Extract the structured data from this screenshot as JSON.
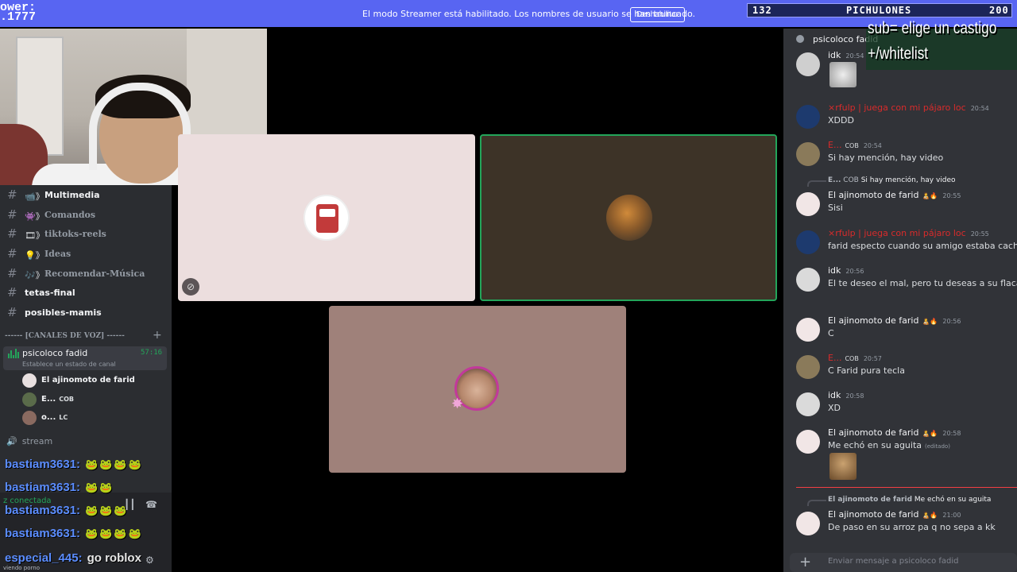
{
  "stream_overlay": {
    "top_left_text": [
      "ower:",
      ".1777"
    ],
    "counter": {
      "current": "132",
      "label": "PICHULONES",
      "goal": "200"
    },
    "sub_lines": [
      "sub= elige un castigo",
      "+/whitelist"
    ]
  },
  "banner": {
    "text": "El modo Streamer está habilitado. Los nombres de usuario se han truncado.",
    "button": "Deshabilitar"
  },
  "sidebar": {
    "channels": [
      {
        "emoji": "📹》",
        "name": "Multimedia",
        "unread": true
      },
      {
        "emoji": "👾》",
        "name": "Comandos",
        "unread": false
      },
      {
        "emoji": "🎞》",
        "name": "tiktoks-reels",
        "unread": false
      },
      {
        "emoji": "💡》",
        "name": "Ideas",
        "unread": false
      },
      {
        "emoji": "🎶》",
        "name": "Recomendar-Música",
        "unread": false
      },
      {
        "emoji": "",
        "name": "tetas-final",
        "unread": true
      },
      {
        "emoji": "",
        "name": "posibles-mamis",
        "unread": true
      }
    ],
    "voice_header": "------ [CANALES DE VOZ] ------",
    "active_voice": {
      "name": "psicoloco fadid",
      "time": "57:16",
      "status": "Establece un estado de canal"
    },
    "voice_users": [
      {
        "name": "El ajinomoto de farid",
        "tag": "",
        "color": "#e8e0e0"
      },
      {
        "name": "E...",
        "tag": "COB",
        "color": "#5a6b4a"
      },
      {
        "name": "o...",
        "tag": "LC",
        "color": "#8a6a60"
      }
    ],
    "stream_channel": "stream"
  },
  "chat_overlay": [
    {
      "user": "bastiam3631:",
      "extra": "🐸🐸🐸🐸"
    },
    {
      "user": "bastiam3631:",
      "extra": "🐸🐸"
    },
    {
      "user": "bastiam3631:",
      "extra": "🐸🐸🐸"
    },
    {
      "user": "bastiam3631:",
      "extra": "🐸🐸🐸🐸"
    },
    {
      "user": "especial_445:",
      "extra": "go roblox"
    }
  ],
  "user_panel": {
    "connected": "z conectada",
    "activity": "viendo porno"
  },
  "chat": {
    "channel_name": "psicoloco fadid",
    "input_placeholder": "Enviar mensaje a psicoloco fadid",
    "messages": [
      {
        "name": "idk",
        "red": false,
        "tag": "",
        "time": "20:54",
        "text": ""
      },
      {
        "name": "×rfulp | juega con mi pájaro loc",
        "red": true,
        "tag": "",
        "time": "20:54",
        "text": "XDDD"
      },
      {
        "name": "E...",
        "red": true,
        "tag": "COB",
        "time": "20:54",
        "text": "Si hay mención, hay video"
      },
      {
        "name": "El ajinomoto de farid",
        "red": false,
        "tag": "🧑‍🍼🔥",
        "time": "20:55",
        "text": "Sisi",
        "reply": {
          "name": "E...",
          "tag": "COB",
          "text": "Si hay mención, hay video"
        }
      },
      {
        "name": "×rfulp | juega con mi pájaro loc",
        "red": true,
        "tag": "",
        "time": "20:55",
        "text": "farid especto cuando su amigo estaba cachando"
      },
      {
        "name": "idk",
        "red": false,
        "tag": "",
        "time": "20:56",
        "text": "El te deseo el mal, pero tu deseas a su flaca, tu g"
      },
      {
        "name": "El ajinomoto de farid",
        "red": false,
        "tag": "🧑‍🍼🔥",
        "time": "20:56",
        "text": "C"
      },
      {
        "name": "E...",
        "red": true,
        "tag": "COB",
        "time": "20:57",
        "text": "C Farid pura tecla"
      },
      {
        "name": "idk",
        "red": false,
        "tag": "",
        "time": "20:58",
        "text": "XD"
      },
      {
        "name": "El ajinomoto de farid",
        "red": false,
        "tag": "🧑‍🍼🔥",
        "time": "20:58",
        "text": "Me echó en su aguita",
        "edited": "(editado)"
      },
      {
        "name": "El ajinomoto de farid",
        "red": false,
        "tag": "🧑‍🍼🔥",
        "time": "21:00",
        "text": "De paso en su arroz pa q no sepa a kk",
        "reply": {
          "name": "El ajinomoto de farid",
          "tag": "",
          "text": "Me echó en su aguita"
        }
      }
    ]
  },
  "colors": {
    "blurple": "#5865f2",
    "online": "#23a55a",
    "mention_red": "#d92b2b",
    "sidebar": "#2b2d31",
    "chat_bg": "#313338"
  }
}
